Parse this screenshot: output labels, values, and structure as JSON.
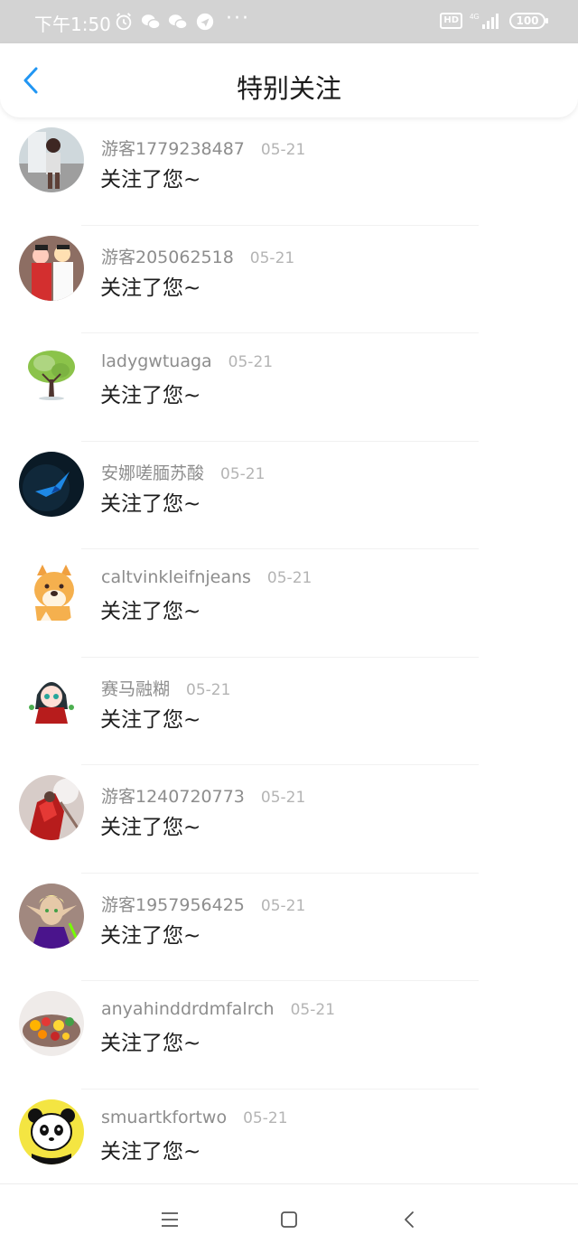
{
  "status_bar": {
    "time": "下午1:50",
    "dots": "···",
    "hd": "HD",
    "network": "4G",
    "battery": "100",
    "icons": [
      "alarm-icon",
      "wechat-icon",
      "wechat-icon",
      "app-notify-icon"
    ]
  },
  "header": {
    "title": "特别关注",
    "back_icon": "chevron-left-icon"
  },
  "items": [
    {
      "name": "游客1779238487",
      "date": "05-21",
      "message": "关注了您~"
    },
    {
      "name": "游客205062518",
      "date": "05-21",
      "message": "关注了您~"
    },
    {
      "name": "ladygwtuaga",
      "date": "05-21",
      "message": "关注了您~"
    },
    {
      "name": "安娜嗟腼苏酸",
      "date": "05-21",
      "message": "关注了您~"
    },
    {
      "name": "caltvinkleifnjeans",
      "date": "05-21",
      "message": "关注了您~"
    },
    {
      "name": "赛马融糊",
      "date": "05-21",
      "message": "关注了您~"
    },
    {
      "name": "游客1240720773",
      "date": "05-21",
      "message": "关注了您~"
    },
    {
      "name": "游客1957956425",
      "date": "05-21",
      "message": "关注了您~"
    },
    {
      "name": "anyahinddrdmfalrch",
      "date": "05-21",
      "message": "关注了您~"
    },
    {
      "name": "smuartkfortwo",
      "date": "05-21",
      "message": "关注了您~"
    }
  ],
  "nav_bar": {
    "icons": [
      "menu-icon",
      "home-icon",
      "back-icon"
    ]
  },
  "colors": {
    "accent": "#2196f3",
    "status_bar_bg": "#d3d3d3",
    "name_text": "#8d8d8d",
    "date_text": "#b4b4b4"
  }
}
